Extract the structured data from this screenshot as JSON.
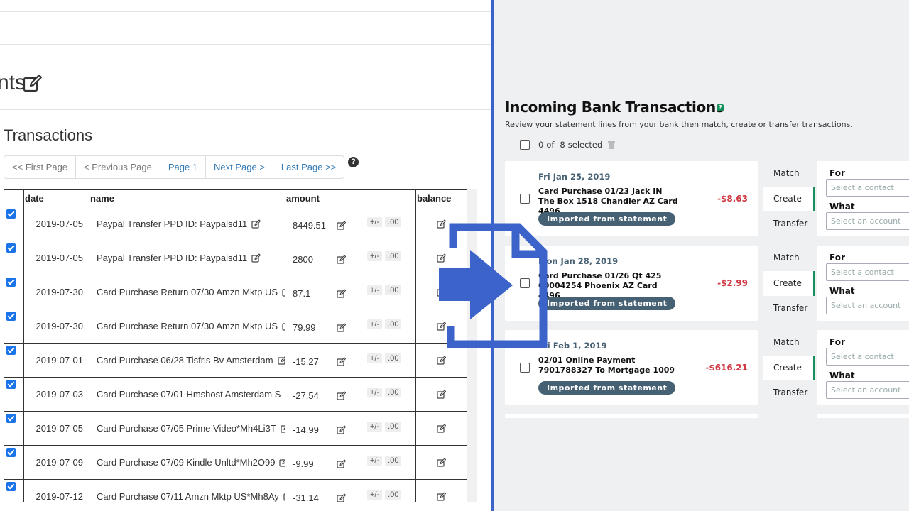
{
  "left": {
    "heading": "nts",
    "section_title": "Transactions",
    "pager": [
      "<< First Page",
      "< Previous Page",
      "Page 1",
      "Next Page >",
      "Last Page >>"
    ],
    "help": "?",
    "columns": [
      "",
      "date",
      "name",
      "amount",
      "balance"
    ],
    "rows": [
      {
        "date": "2019-07-05",
        "name": "Paypal Transfer PPD ID: Paypalsd11",
        "amount": "8449.51"
      },
      {
        "date": "2019-07-05",
        "name": "Paypal Transfer PPD ID: Paypalsd11",
        "amount": "2800"
      },
      {
        "date": "2019-07-30",
        "name": "Card Purchase Return 07/30 Amzn Mktp US",
        "amount": "87.1"
      },
      {
        "date": "2019-07-30",
        "name": "Card Purchase Return 07/30 Amzn Mktp US",
        "amount": "79.99"
      },
      {
        "date": "2019-07-01",
        "name": "Card Purchase 06/28 Tisfris Bv Amsterdam",
        "amount": "-15.27"
      },
      {
        "date": "2019-07-03",
        "name": "Card Purchase 07/01 Hmshost Amsterdam S",
        "amount": "-27.54"
      },
      {
        "date": "2019-07-05",
        "name": "Card Purchase 07/05 Prime Video*Mh4Li3T",
        "amount": "-14.99"
      },
      {
        "date": "2019-07-09",
        "name": "Card Purchase 07/09 Kindle Unltd*Mh2O99",
        "amount": "-9.99"
      },
      {
        "date": "2019-07-12",
        "name": "Card Purchase 07/11 Amzn Mktp US*Mh8Ay",
        "amount": "-31.14"
      }
    ],
    "plus_minus": "+/-",
    "cents": ".00"
  },
  "right": {
    "title": "Incoming Bank Transactions",
    "help": "?",
    "subtitle": "Review your statement lines from your bank then match, create or transfer transactions.",
    "selected_count": "0",
    "selected_of": "of",
    "selected_total": "8",
    "selected_word": "selected",
    "badge": "Imported from statement",
    "tabs": [
      "Match",
      "Create",
      "Transfer"
    ],
    "for_label": "For",
    "what_label": "What",
    "contact_placeholder": "Select a contact",
    "account_placeholder": "Select an account",
    "cards": [
      {
        "date": "Fri Jan 25, 2019",
        "desc": "Card Purchase 01/23 Jack IN The Box 1518 Chandler AZ Card 4496",
        "amount": "-$8.63"
      },
      {
        "date": "Mon Jan 28, 2019",
        "desc": "Card Purchase 01/26 Qt 425 00004254 Phoenix AZ Card 4496",
        "amount": "-$2.99"
      },
      {
        "date": "Fri Feb 1, 2019",
        "desc": "02/01 Online Payment 7901788327 To Mortgage 1009",
        "amount": "-$616.21"
      }
    ]
  },
  "colors": {
    "divider": "#3b63c9",
    "arrow": "#3b63c9",
    "badge": "#466174",
    "negative": "#d03843",
    "accent_green": "#14915a"
  }
}
